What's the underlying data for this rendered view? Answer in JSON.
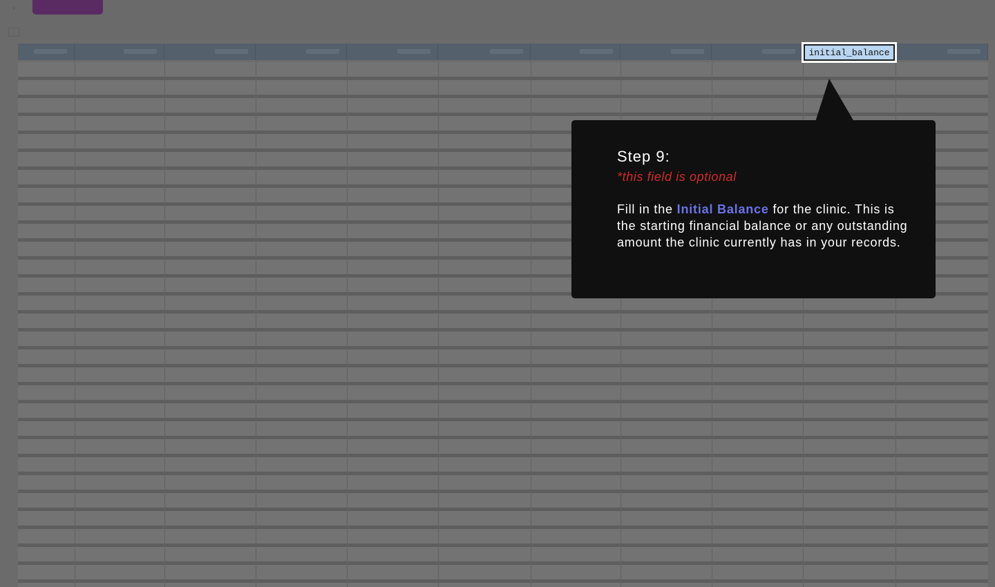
{
  "toolbar": {
    "caret": "›",
    "button_label": ""
  },
  "grid": {
    "columns": 11,
    "rows": 29,
    "highlighted_header": "initial_balance"
  },
  "tooltip": {
    "title": "Step 9:",
    "optional_note": "*this field is optional",
    "body_prefix": "Fill in the ",
    "body_highlight": "Initial Balance",
    "body_suffix": " for the clinic. This is the starting financial balance or any outstanding amount the clinic currently has in your records."
  },
  "colors": {
    "overlay": "#6b6b6b",
    "tooltip_bg": "#101010",
    "optional_red": "#d22b2b",
    "highlight_blue": "#6b73e8",
    "cell_highlight": "#b9d6f1",
    "toolbar_purple": "#5a2a63"
  }
}
